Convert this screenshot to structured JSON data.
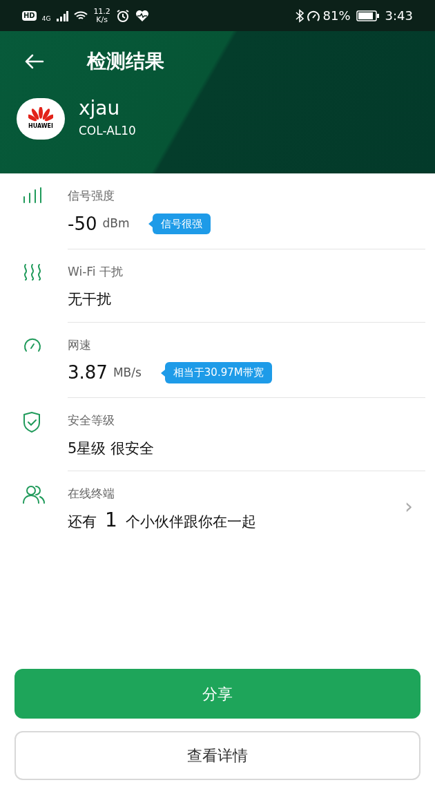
{
  "status_bar": {
    "hd": "HD",
    "network": "4G",
    "speed": "11.2",
    "speed_unit": "K/s",
    "battery": "81%",
    "time": "3:43"
  },
  "header": {
    "title": "检测结果",
    "network_name": "xjau",
    "device": "COL-AL10",
    "logo_text": "HUAWEI"
  },
  "items": [
    {
      "kind": "measure",
      "label": "信号强度",
      "value": "-50",
      "unit": "dBm",
      "badge": "信号很强"
    },
    {
      "kind": "text",
      "label": "Wi-Fi 干扰",
      "value": "无干扰"
    },
    {
      "kind": "measure",
      "label": "网速",
      "value": "3.87",
      "unit": "MB/s",
      "badge": "相当于30.97M带宽"
    },
    {
      "kind": "text",
      "label": "安全等级",
      "value": "5星级 很安全"
    },
    {
      "kind": "count",
      "label": "在线终端",
      "before": "还有",
      "count": "1",
      "after": "个小伙伴跟你在一起",
      "chevron": "›"
    }
  ],
  "buttons": {
    "primary": "分享",
    "secondary": "查看详情"
  }
}
